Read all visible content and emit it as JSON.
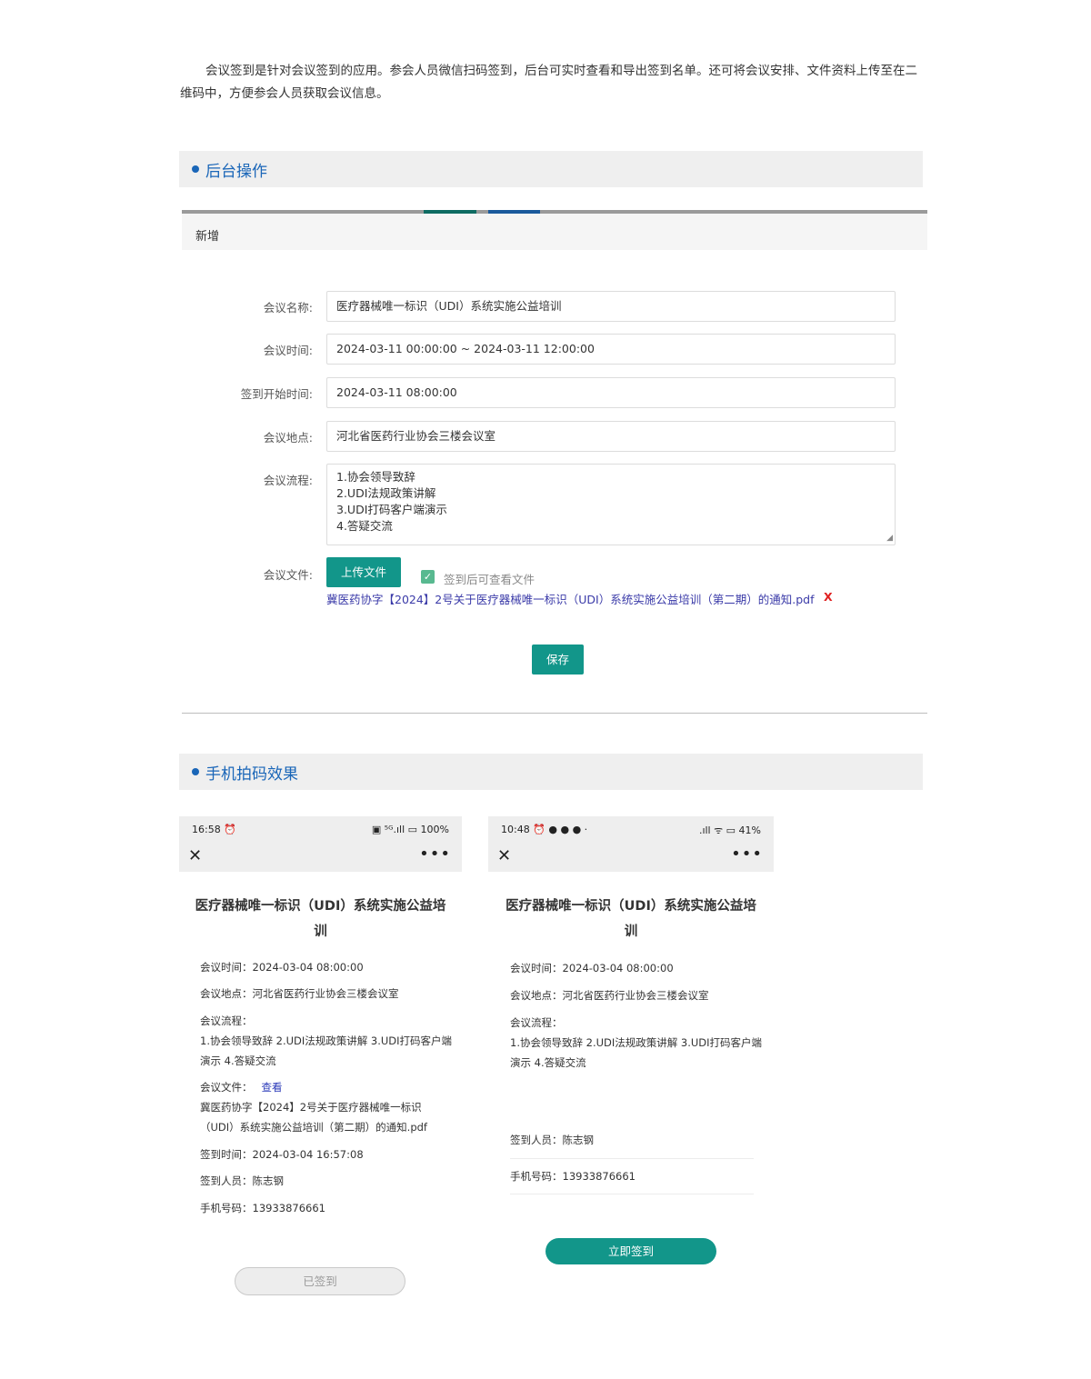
{
  "intro": "会议签到是针对会议签到的应用。参会人员微信扫码签到，后台可实时查看和导出签到名单。还可将会议安排、文件资料上传至在二维码中，方便参会人员获取会议信息。",
  "sections": {
    "backend": "后台操作",
    "mobile": "手机拍码效果"
  },
  "tabbar": {
    "label": "新增"
  },
  "form": {
    "name_label": "会议名称:",
    "name_value": "医疗器械唯一标识（UDI）系统实施公益培训",
    "time_label": "会议时间:",
    "time_value": "2024-03-11 00:00:00 ~ 2024-03-11 12:00:00",
    "checkin_label": "签到开始时间:",
    "checkin_value": "2024-03-11 08:00:00",
    "place_label": "会议地点:",
    "place_value": "河北省医药行业协会三楼会议室",
    "flow_label": "会议流程:",
    "flow_lines": [
      "1.协会领导致辞",
      "2.UDI法规政策讲解",
      "3.UDI打码客户端演示",
      "4.答疑交流"
    ],
    "file_label": "会议文件:",
    "upload_button": "上传文件",
    "view_after_checkin": "签到后可查看文件",
    "file_name": "冀医药协字【2024】2号关于医疗器械唯一标识（UDI）系统实施公益培训（第二期）的通知.pdf",
    "delete_mark": "X",
    "save_button": "保存"
  },
  "phone1": {
    "time": "16:58 ⏰",
    "status_right": "▣ ⁵ᴳ.ıll ▭ 100%",
    "close": "✕",
    "more": "•••",
    "title_line1": "医疗器械唯一标识（UDI）系统实施公益培",
    "title_line2": "训",
    "meeting_time": "会议时间：2024-03-04 08:00:00",
    "meeting_place": "会议地点：河北省医药行业协会三楼会议室",
    "flow_label": "会议流程：",
    "flow_line1": "1.协会领导致辞 2.UDI法规政策讲解 3.UDI打码客户端",
    "flow_line2": "演示 4.答疑交流",
    "file_label": "会议文件：",
    "view_link": "查看",
    "file_line1": "冀医药协字【2024】2号关于医疗器械唯一标识",
    "file_line2": "（UDI）系统实施公益培训（第二期）的通知.pdf",
    "checkin_time": "签到时间：2024-03-04 16:57:08",
    "checkin_person": "签到人员：陈志钢",
    "phone_number": "手机号码：13933876661",
    "signed_button": "已签到"
  },
  "phone2": {
    "time": "10:48 ⏰ ● ● ● ·",
    "status_right": ".ıll ᯤ ▭ 41%",
    "close": "✕",
    "more": "•••",
    "title_line1": "医疗器械唯一标识（UDI）系统实施公益培",
    "title_line2": "训",
    "meeting_time": "会议时间：2024-03-04 08:00:00",
    "meeting_place": "会议地点：河北省医药行业协会三楼会议室",
    "flow_label": "会议流程：",
    "flow_line1": "1.协会领导致辞 2.UDI法规政策讲解 3.UDI打码客户端",
    "flow_line2": "演示 4.答疑交流",
    "checkin_person": "签到人员：陈志钢",
    "phone_number": "手机号码：13933876661",
    "sign_button": "立即签到"
  },
  "colors": {
    "accent_blue": "#1a66b8",
    "teal": "#12968a",
    "link": "#3a3aa8",
    "delete_red": "#e02020"
  }
}
